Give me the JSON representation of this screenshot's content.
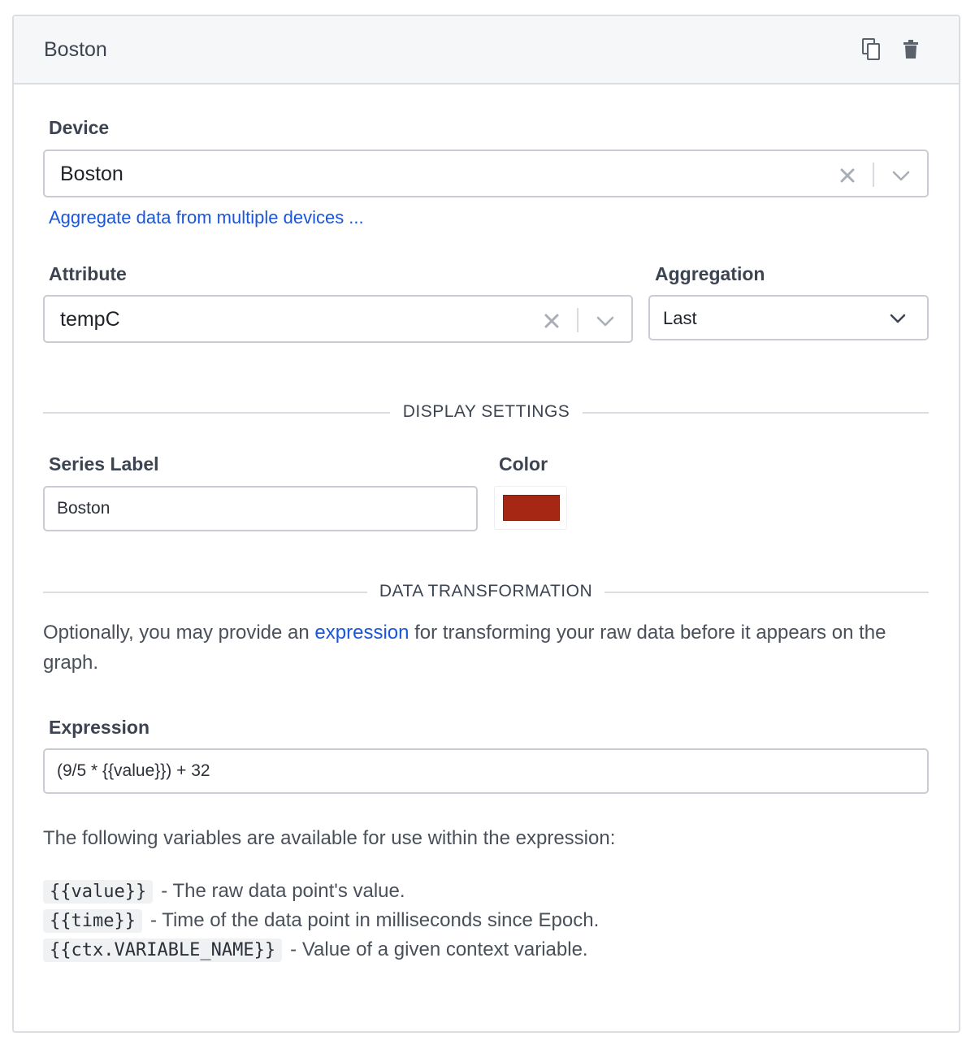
{
  "card": {
    "title": "Boston",
    "actions": [
      {
        "icon": "copy-icon"
      },
      {
        "icon": "trash-icon"
      }
    ]
  },
  "device": {
    "label": "Device",
    "value": "Boston",
    "aggregate_link": "Aggregate data from multiple devices ..."
  },
  "attribute": {
    "label": "Attribute",
    "value": "tempC"
  },
  "aggregation": {
    "label": "Aggregation",
    "value": "Last"
  },
  "display_settings": {
    "heading": "DISPLAY SETTINGS",
    "series_label": "Series Label",
    "series_value": "Boston",
    "color_label": "Color",
    "color_value": "#a52714"
  },
  "data_transformation": {
    "heading": "DATA TRANSFORMATION",
    "intro_before": "Optionally, you may provide an ",
    "intro_link": "expression",
    "intro_after": " for transforming your raw data before it appears on the graph.",
    "expression_label": "Expression",
    "expression_value": "(9/5 * {{value}}) + 32",
    "variables_intro": "The following variables are available for use within the expression:",
    "variables": [
      {
        "code": "{{value}}",
        "desc": "- The raw data point's value."
      },
      {
        "code": "{{time}}",
        "desc": "- Time of the data point in milliseconds since Epoch."
      },
      {
        "code": "{{ctx.VARIABLE_NAME}}",
        "desc": "- Value of a given context variable."
      }
    ]
  },
  "colors": {
    "link": "#1a56db",
    "border": "#c9cdd3",
    "header_bg": "#f6f7f8"
  }
}
